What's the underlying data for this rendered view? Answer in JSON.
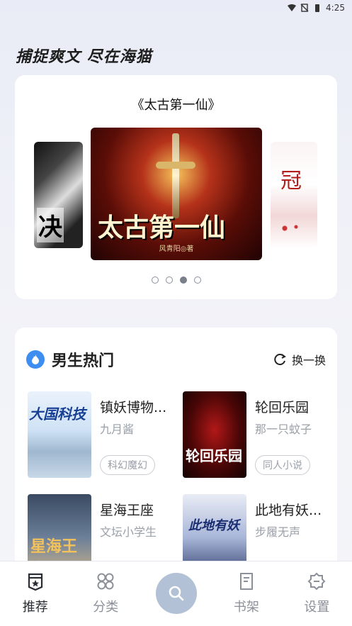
{
  "status_bar": {
    "time": "4:25"
  },
  "header": {
    "slogan": "捕捉爽文  尽在海猫"
  },
  "banner": {
    "title": "《太古第一仙》",
    "main_cover_text": "太古第一仙",
    "main_cover_author": "风青阳◎著",
    "left_cover_text": "决",
    "right_cover_text": "冠",
    "pages": 4,
    "active_page": 3
  },
  "section": {
    "title": "男生热门",
    "refresh_label": "换一换",
    "books": [
      {
        "name": "镇妖博物...",
        "author": "九月酱",
        "tag": "科幻魔幻",
        "cover_text": "大国科技"
      },
      {
        "name": "轮回乐园",
        "author": "那一只蚊子",
        "tag": "同人小说",
        "cover_text": "轮回乐园"
      },
      {
        "name": "星海王座",
        "author": "文坛小学生",
        "tag": "",
        "cover_text": "星海王座"
      },
      {
        "name": "此地有妖...",
        "author": "步履无声",
        "tag": "",
        "cover_text": "此地有妖"
      }
    ]
  },
  "tabbar": {
    "items": [
      {
        "label": "推荐",
        "icon": "recommend-icon",
        "active": true
      },
      {
        "label": "分类",
        "icon": "category-icon",
        "active": false
      },
      {
        "label": "",
        "icon": "search-icon",
        "active": false
      },
      {
        "label": "书架",
        "icon": "bookshelf-icon",
        "active": false
      },
      {
        "label": "设置",
        "icon": "settings-icon",
        "active": false
      }
    ]
  },
  "colors": {
    "accent": "#3d8ef0",
    "fab": "#b2c1d6",
    "muted": "#9aa0a8"
  }
}
